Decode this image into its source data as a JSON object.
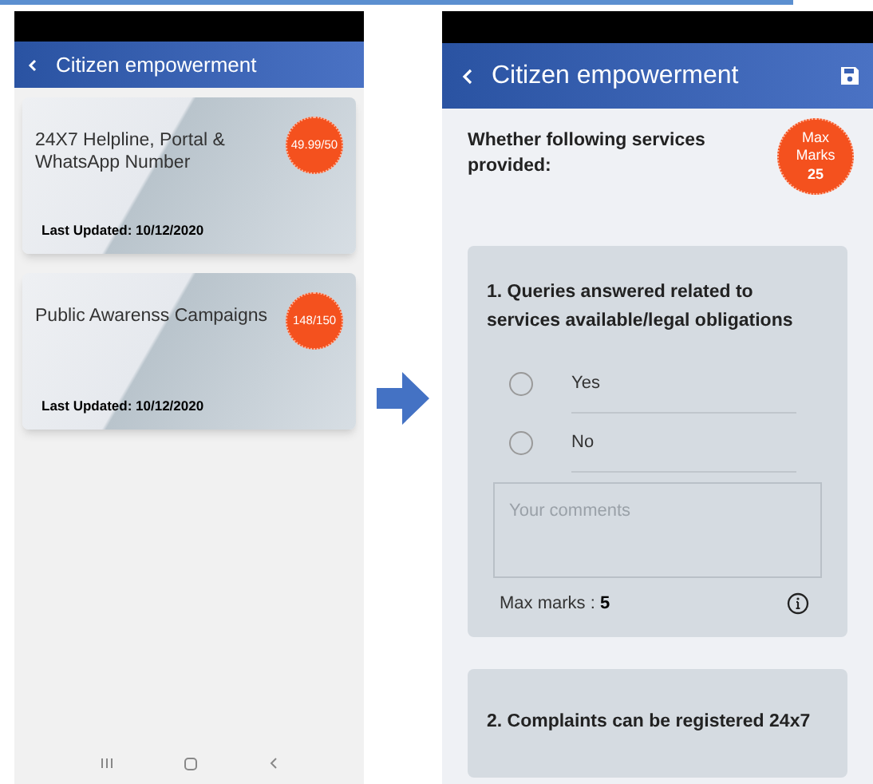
{
  "list_screen": {
    "title": "Citizen empowerment",
    "cards": [
      {
        "title": "24X7 Helpline, Portal & WhatsApp Number",
        "score": "49.99/50",
        "updated": "Last Updated: 10/12/2020"
      },
      {
        "title": "Public Awarenss Campaigns",
        "score": "148/150",
        "updated": "Last Updated: 10/12/2020"
      }
    ]
  },
  "detail_screen": {
    "title": "Citizen empowerment",
    "heading": "Whether following services provided:",
    "max_badge": [
      "Max",
      "Marks",
      "25"
    ],
    "questions": [
      {
        "text": "1. Queries answered related to services available/legal obligations",
        "options": [
          {
            "label": "Yes",
            "selected": false
          },
          {
            "label": "No",
            "selected": false
          }
        ],
        "comment_placeholder": "Your comments",
        "max_label": "Max marks : ",
        "max_value": "5"
      },
      {
        "text": "2. Complaints can be registered 24x7"
      }
    ]
  }
}
